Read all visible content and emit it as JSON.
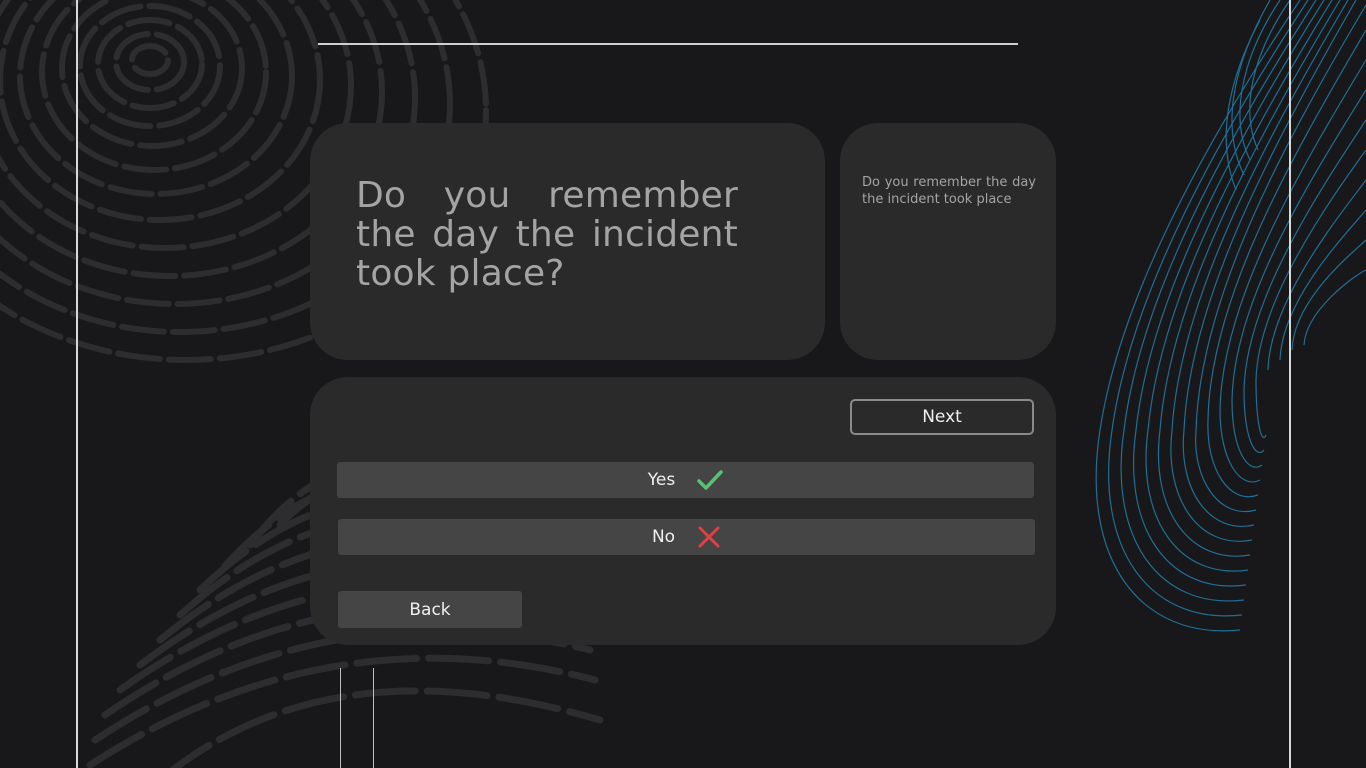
{
  "question": {
    "text": "Do you remember the day the incident took place?"
  },
  "note": {
    "text": "Do you remember the day the incident took place"
  },
  "buttons": {
    "next_label": "Next",
    "back_label": "Back"
  },
  "answers": [
    {
      "label": "Yes",
      "icon": "check-icon",
      "color": "#5bbf74"
    },
    {
      "label": "No",
      "icon": "cross-icon",
      "color": "#e0403f"
    }
  ],
  "colors": {
    "background": "#18181a",
    "card": "#2a2a2b",
    "button": "#454546",
    "accent_curves": "#1f6f96"
  }
}
